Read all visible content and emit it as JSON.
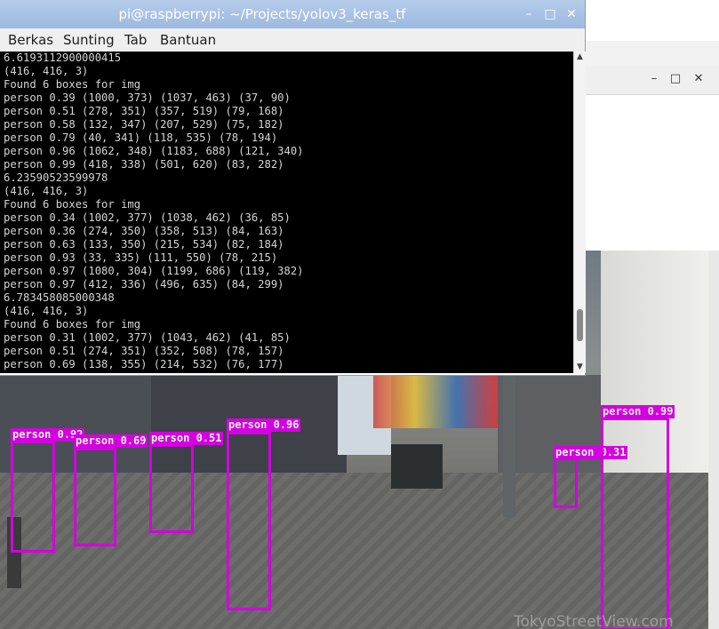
{
  "terminal": {
    "title": "pi@raspberrypi: ~/Projects/yolov3_keras_tf",
    "controls": {
      "minimize": "–",
      "maximize": "□",
      "close": "✕"
    },
    "menu": [
      "Berkas",
      "Sunting",
      "Tab",
      "Bantuan"
    ],
    "lines": [
      "6.6193112900000415",
      "(416, 416, 3)",
      "Found 6 boxes for img",
      "person 0.39 (1000, 373) (1037, 463) (37, 90)",
      "person 0.51 (278, 351) (357, 519) (79, 168)",
      "person 0.58 (132, 347) (207, 529) (75, 182)",
      "person 0.79 (40, 341) (118, 535) (78, 194)",
      "person 0.96 (1062, 348) (1183, 688) (121, 340)",
      "person 0.99 (418, 338) (501, 620) (83, 282)",
      "6.23590523599978",
      "(416, 416, 3)",
      "Found 6 boxes for img",
      "person 0.34 (1002, 377) (1038, 462) (36, 85)",
      "person 0.36 (274, 350) (358, 513) (84, 163)",
      "person 0.63 (133, 350) (215, 534) (82, 184)",
      "person 0.93 (33, 335) (111, 550) (78, 215)",
      "person 0.97 (1080, 304) (1199, 686) (119, 382)",
      "person 0.97 (412, 336) (496, 635) (84, 299)",
      "6.783458085000348",
      "(416, 416, 3)",
      "Found 6 boxes for img",
      "person 0.31 (1002, 377) (1043, 462) (41, 85)",
      "person 0.51 (274, 351) (352, 508) (78, 157)",
      "person 0.69 (138, 355) (214, 532) (76, 177)"
    ]
  },
  "background_window": {
    "controls": {
      "minimize": "–",
      "maximize": "□",
      "close": "✕"
    }
  },
  "video": {
    "watermark": "TokyoStreetView.com",
    "detections": [
      {
        "label": "person 0.92"
      },
      {
        "label": "person 0.69"
      },
      {
        "label": "person 0.51"
      },
      {
        "label": "person 0.96"
      },
      {
        "label": "person 0.31"
      },
      {
        "label": "person 0.99"
      }
    ],
    "box_color": "#d400e0"
  },
  "colors": {
    "titlebar": "#a9c3e6",
    "terminal_bg": "#000000",
    "terminal_fg": "#d4d4d4"
  }
}
